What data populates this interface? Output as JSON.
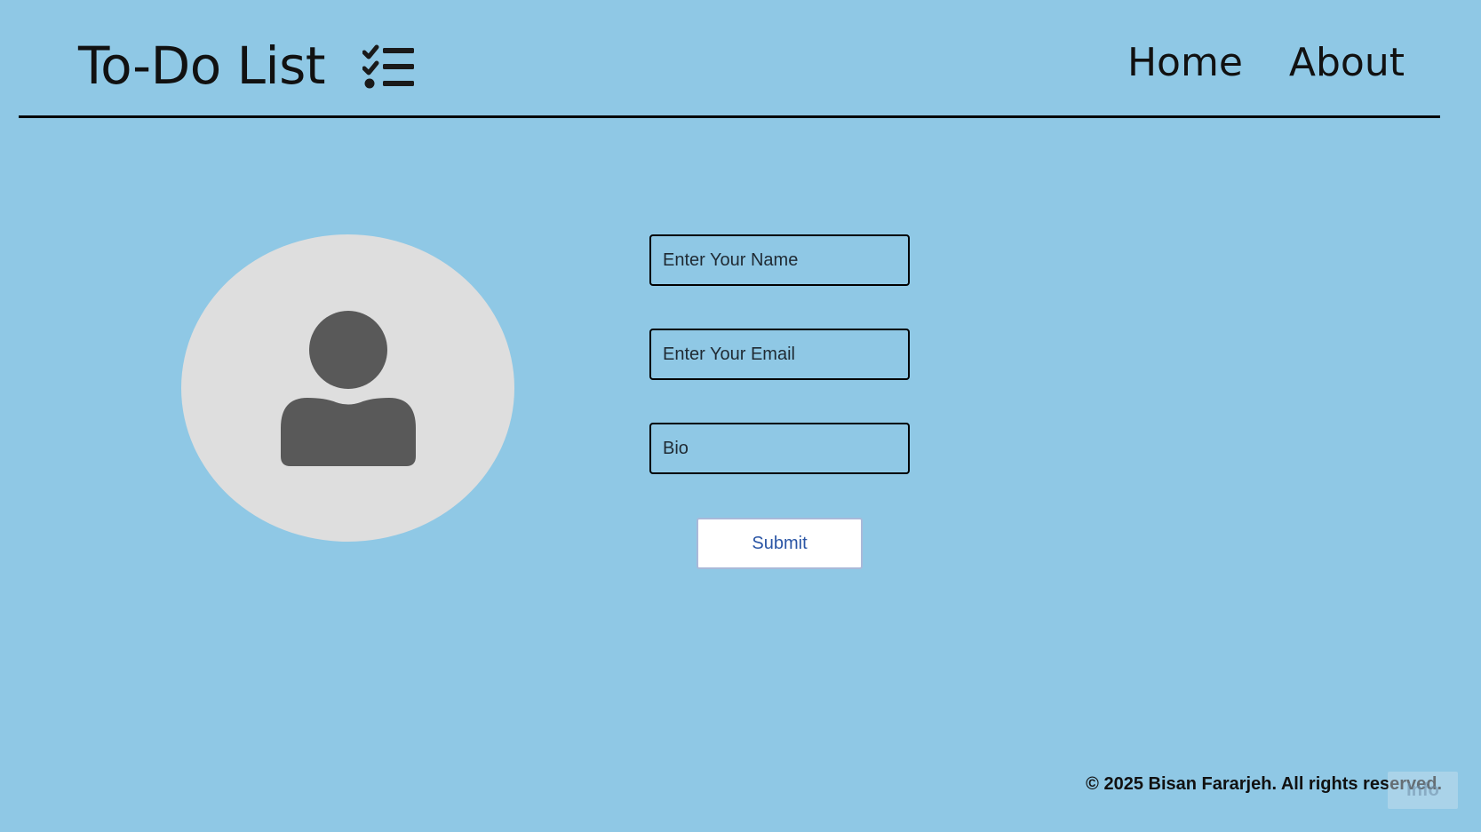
{
  "header": {
    "title": "To-Do List",
    "title_icon": "list-check-icon",
    "nav": [
      {
        "label": "Home"
      },
      {
        "label": "About"
      }
    ]
  },
  "profile": {
    "avatar_icon": "user-icon",
    "name_placeholder": "Enter Your Name",
    "email_placeholder": "Enter Your Email",
    "bio_placeholder": "Bio",
    "submit_label": "Submit"
  },
  "footer": {
    "text": "© 2025 Bisan Fararjeh. All rights reserved.",
    "info_label": "Info"
  },
  "colors": {
    "background": "#8fc8e5",
    "avatar_bg": "#dedede",
    "avatar_icon": "#595959",
    "submit_text": "#2a55a5"
  }
}
